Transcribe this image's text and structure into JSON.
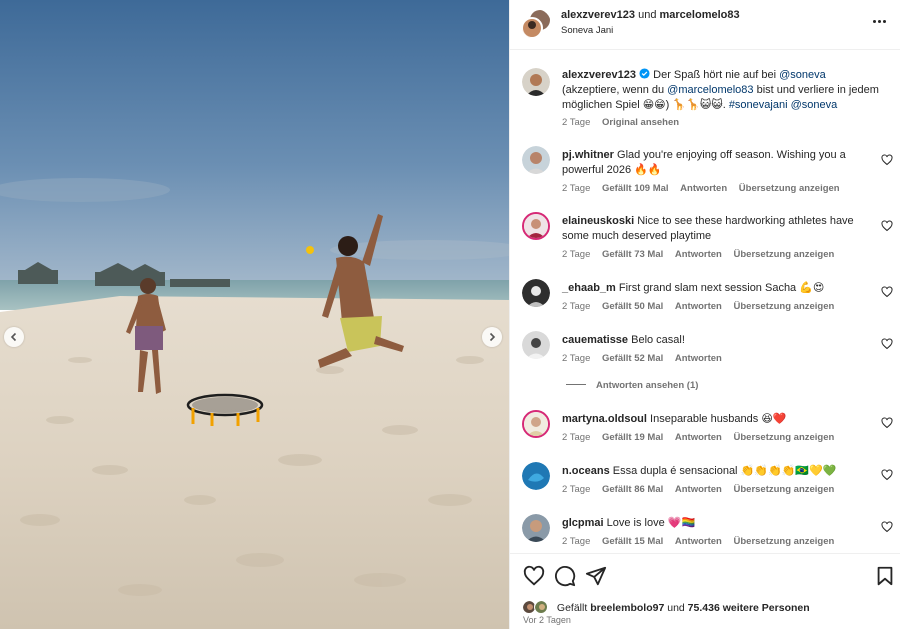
{
  "post": {
    "author": "alexzverev123",
    "connector": "und",
    "coauthor": "marcelomelo83",
    "location": "Soneva Jani",
    "more_icon": "more-horizontal-icon"
  },
  "caption": {
    "username": "alexzverev123",
    "text_1": "Der Spaß hört nie auf bei ",
    "mention_1": "@soneva",
    "text_2": " (akzeptiere, wenn du ",
    "mention_2": "@marcelomelo83",
    "text_3": " bist und verliere in jedem möglichen Spiel 😁😁) 🦒🦒😺😺. ",
    "hashtag": "#sonevajani",
    "space": " ",
    "mention_3": "@soneva",
    "time": "2 Tage",
    "see_original": "Original ansehen"
  },
  "comments": [
    {
      "username": "pj.whitner",
      "text": "Glad you're enjoying off season. Wishing you a powerful 2026 🔥🔥",
      "time": "2 Tage",
      "likes": "Gefällt 109 Mal",
      "reply": "Antworten",
      "translate": "Übersetzung anzeigen"
    },
    {
      "username": "elaineuskoski",
      "text": "Nice to see these hardworking athletes have some much deserved playtime",
      "time": "2 Tage",
      "likes": "Gefällt 73 Mal",
      "reply": "Antworten",
      "translate": "Übersetzung anzeigen"
    },
    {
      "username": "_ehaab_m",
      "text": "First grand slam next session Sacha 💪😍",
      "time": "2 Tage",
      "likes": "Gefällt 50 Mal",
      "reply": "Antworten",
      "translate": "Übersetzung anzeigen"
    },
    {
      "username": "cauematisse",
      "text": "Belo casal!",
      "time": "2 Tage",
      "likes": "Gefällt 52 Mal",
      "reply": "Antworten",
      "translate": ""
    },
    {
      "username": "martyna.oldsoul",
      "text": "Inseparable husbands 😆❤️",
      "time": "2 Tage",
      "likes": "Gefällt 19 Mal",
      "reply": "Antworten",
      "translate": "Übersetzung anzeigen"
    },
    {
      "username": "n.oceans",
      "text": "Essa dupla é sensacional 👏👏👏👏🇧🇷💛💚",
      "time": "2 Tage",
      "likes": "Gefällt 86 Mal",
      "reply": "Antworten",
      "translate": "Übersetzung anzeigen"
    },
    {
      "username": "glcpmai",
      "text": "Love is love 💗🏳️‍🌈",
      "time": "2 Tage",
      "likes": "Gefällt 15 Mal",
      "reply": "Antworten",
      "translate": "Übersetzung anzeigen"
    }
  ],
  "view_replies": "Antworten ansehen (1)",
  "likes": {
    "prefix": "Gefällt ",
    "first_user": "breelembolo97",
    "connector": " und ",
    "others": "75.436 weitere Personen"
  },
  "timeago": "Vor 2 Tagen",
  "icons": {
    "like": "heart-icon",
    "comment": "comment-icon",
    "share": "paper-plane-icon",
    "save": "bookmark-icon",
    "prev": "chevron-left-icon",
    "next": "chevron-right-icon"
  },
  "colors": {
    "link": "#00376b",
    "verified": "#0095f6",
    "muted": "#737373",
    "text": "#262626"
  }
}
